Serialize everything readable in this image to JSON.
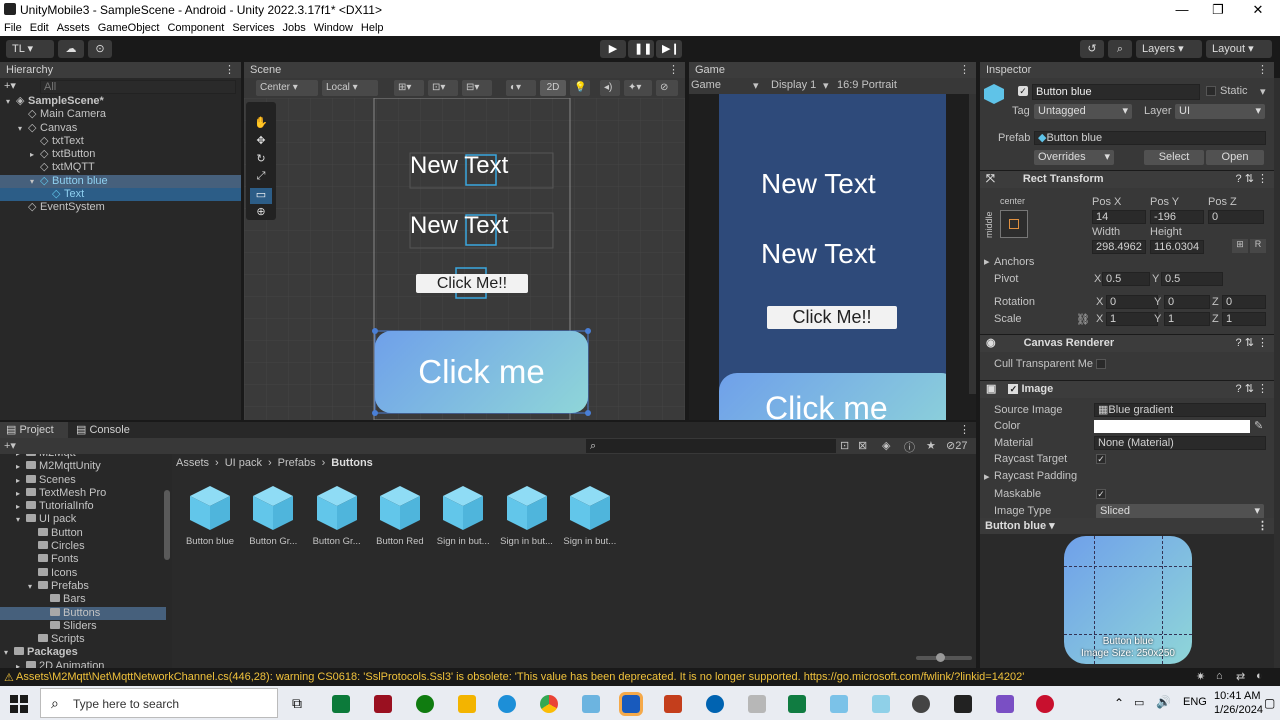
{
  "window": {
    "title": "UnityMobile3 - SampleScene - Android - Unity 2022.3.17f1* <DX11>"
  },
  "menu": [
    "File",
    "Edit",
    "Assets",
    "GameObject",
    "Component",
    "Services",
    "Jobs",
    "Window",
    "Help"
  ],
  "toolbar": {
    "account": "TL ▾",
    "layers": "Layers",
    "layout": "Layout"
  },
  "hierarchy": {
    "tab": "Hierarchy",
    "search_placeholder": "All",
    "items": [
      {
        "label": "SampleScene*",
        "depth": 0
      },
      {
        "label": "Main Camera",
        "depth": 1
      },
      {
        "label": "Canvas",
        "depth": 1
      },
      {
        "label": "txtText",
        "depth": 2
      },
      {
        "label": "txtButton",
        "depth": 2
      },
      {
        "label": "txtMQTT",
        "depth": 2
      },
      {
        "label": "Button blue",
        "depth": 2
      },
      {
        "label": "Text",
        "depth": 3
      },
      {
        "label": "EventSystem",
        "depth": 1
      }
    ]
  },
  "scene": {
    "tab": "Scene",
    "pivot": "Center",
    "space": "Local",
    "mode2d": "2D",
    "text1": "New Text",
    "text2": "New Text",
    "button_small": "Click Me!!",
    "button_big": "Click me"
  },
  "game": {
    "tab": "Game",
    "mode": "Game",
    "display": "Display 1",
    "aspect": "16:9 Portrait",
    "text1": "New Text",
    "text2": "New Text",
    "button_small": "Click Me!!",
    "button_big": "Click me"
  },
  "inspector": {
    "tab": "Inspector",
    "object_name": "Button blue",
    "static_label": "Static",
    "tag_label": "Tag",
    "tag_value": "Untagged",
    "layer_label": "Layer",
    "layer_value": "UI",
    "prefab_label": "Prefab",
    "prefab_value": "Button blue",
    "overrides": "Overrides",
    "select": "Select",
    "open": "Open",
    "rect_transform": {
      "title": "Rect Transform",
      "anchor_h": "center",
      "anchor_v": "middle",
      "posx_label": "Pos X",
      "posy_label": "Pos Y",
      "posz_label": "Pos Z",
      "posx": "14",
      "posy": "-196",
      "posz": "0",
      "width_label": "Width",
      "height_label": "Height",
      "width": "298.4962",
      "height": "116.0304",
      "anchors": "Anchors",
      "pivot": "Pivot",
      "pivot_x": "0.5",
      "pivot_y": "0.5",
      "rotation": "Rotation",
      "rot_x": "0",
      "rot_y": "0",
      "rot_z": "0",
      "scale": "Scale",
      "scale_x": "1",
      "scale_y": "1",
      "scale_z": "1",
      "x": "X",
      "y": "Y",
      "z": "Z",
      "r_btn": "R"
    },
    "canvas_renderer": {
      "title": "Canvas Renderer",
      "cull": "Cull Transparent Me"
    },
    "image": {
      "title": "Image",
      "source_label": "Source Image",
      "source_value": "Blue gradient",
      "color_label": "Color",
      "material_label": "Material",
      "material_value": "None (Material)",
      "raycast_target": "Raycast Target",
      "raycast_padding": "Raycast Padding",
      "maskable": "Maskable",
      "image_type_label": "Image Type",
      "image_type_value": "Sliced"
    },
    "preview": {
      "title": "Button blue ▾",
      "caption1": "Button blue",
      "caption2": "Image Size: 250x250"
    }
  },
  "project": {
    "tab": "Project",
    "console_tab": "Console",
    "count": "27",
    "breadcrumb": [
      "Assets",
      "UI pack",
      "Prefabs",
      "Buttons"
    ],
    "tree": [
      {
        "label": "M2Mqtt",
        "depth": 1
      },
      {
        "label": "M2MqttUnity",
        "depth": 1
      },
      {
        "label": "Scenes",
        "depth": 1
      },
      {
        "label": "TextMesh Pro",
        "depth": 1
      },
      {
        "label": "TutorialInfo",
        "depth": 1
      },
      {
        "label": "UI pack",
        "depth": 1
      },
      {
        "label": "Button",
        "depth": 2
      },
      {
        "label": "Circles",
        "depth": 2
      },
      {
        "label": "Fonts",
        "depth": 2
      },
      {
        "label": "Icons",
        "depth": 2
      },
      {
        "label": "Prefabs",
        "depth": 2
      },
      {
        "label": "Bars",
        "depth": 3
      },
      {
        "label": "Buttons",
        "depth": 3
      },
      {
        "label": "Sliders",
        "depth": 3
      },
      {
        "label": "Scripts",
        "depth": 2
      },
      {
        "label": "Packages",
        "depth": 0
      },
      {
        "label": "2D Animation",
        "depth": 1
      }
    ],
    "assets": [
      "Button blue",
      "Button Gr...",
      "Button Gr...",
      "Button Red",
      "Sign in but...",
      "Sign in but...",
      "Sign in but..."
    ]
  },
  "status": {
    "message": "Assets\\M2Mqtt\\Net\\MqttNetworkChannel.cs(446,28): warning CS0618: 'SslProtocols.Ssl3' is obsolete: 'This value has been deprecated.  It is no longer supported. https://go.microsoft.com/fwlink/?linkid=14202'"
  },
  "taskbar": {
    "search_placeholder": "Type here to search",
    "lang": "ENG",
    "time": "10:41 AM",
    "date": "1/26/2024"
  },
  "colors": {
    "accent": "#2c5d87",
    "game_bg": "#2e4a7a",
    "warning": "#f0c23c"
  }
}
